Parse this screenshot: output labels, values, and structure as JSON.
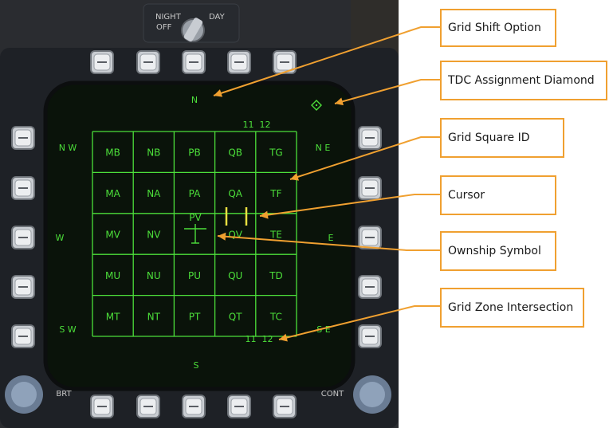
{
  "colors": {
    "screen_green": "#4cdf3a",
    "callout_orange": "#f0a030",
    "bezel_dark": "#1e2126",
    "screen_bg": "#0a130a"
  },
  "bezel": {
    "knob_label_night": "NIGHT",
    "knob_label_day": "DAY",
    "knob_label_off": "OFF",
    "brt_label": "BRT",
    "cont_label": "CONT"
  },
  "display": {
    "compass": {
      "n": "N",
      "ne": "N E",
      "e": "E",
      "se": "S E",
      "s": "S",
      "sw": "S W",
      "w": "W",
      "nw": "N W"
    },
    "zone_top": "11  12",
    "zone_bottom": "11  12",
    "ownship_label": "PV",
    "grid": [
      [
        "MB",
        "NB",
        "PB",
        "QB",
        "TG"
      ],
      [
        "MA",
        "NA",
        "PA",
        "QA",
        "TF"
      ],
      [
        "MV",
        "NV",
        "",
        "QV",
        "TE"
      ],
      [
        "MU",
        "NU",
        "PU",
        "QU",
        "TD"
      ],
      [
        "MT",
        "NT",
        "PT",
        "QT",
        "TC"
      ]
    ]
  },
  "callouts": {
    "grid_shift": "Grid Shift Option",
    "tdc_diamond": "TDC Assignment Diamond",
    "grid_square_id": "Grid Square ID",
    "cursor": "Cursor",
    "ownship": "Ownship Symbol",
    "grid_zone": "Grid Zone Intersection"
  }
}
